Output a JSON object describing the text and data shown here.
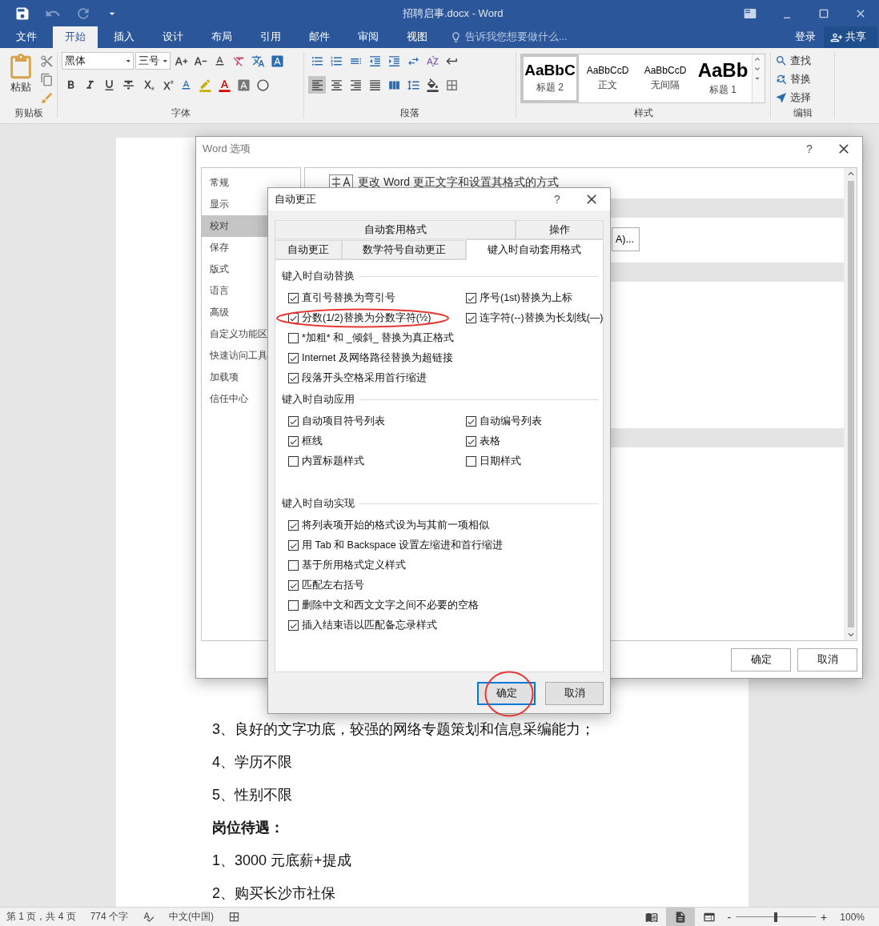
{
  "window": {
    "title": "招聘启事.docx - Word"
  },
  "ribbon_tabs": [
    {
      "label": "文件",
      "selected": false
    },
    {
      "label": "开始",
      "selected": true
    },
    {
      "label": "插入",
      "selected": false
    },
    {
      "label": "设计",
      "selected": false
    },
    {
      "label": "布局",
      "selected": false
    },
    {
      "label": "引用",
      "selected": false
    },
    {
      "label": "邮件",
      "selected": false
    },
    {
      "label": "审阅",
      "selected": false
    },
    {
      "label": "视图",
      "selected": false
    }
  ],
  "tell_me": {
    "placeholder": "告诉我您想要做什么..."
  },
  "account": {
    "sign_in": "登录",
    "share": "共享"
  },
  "ribbon": {
    "clipboard": {
      "paste": "粘贴",
      "label": "剪贴板"
    },
    "font": {
      "name": "黑体",
      "size": "三号",
      "label": "字体"
    },
    "paragraph": {
      "label": "段落"
    },
    "styles": {
      "label": "样式",
      "items": [
        {
          "sample": "AaBbC",
          "name": "标题 2",
          "kind": "heading2",
          "selected": true
        },
        {
          "sample": "AaBbCcD",
          "name": "正文",
          "kind": "body",
          "selected": false
        },
        {
          "sample": "AaBbCcD",
          "name": "无间隔",
          "kind": "body",
          "selected": false
        },
        {
          "sample": "AaBb",
          "name": "标题 1",
          "kind": "heading1",
          "selected": false
        }
      ]
    },
    "editing": {
      "label": "编辑",
      "items": [
        {
          "kind": "find",
          "label": "查找"
        },
        {
          "kind": "replace",
          "label": "替换"
        },
        {
          "kind": "select",
          "label": "选择"
        }
      ]
    }
  },
  "document": {
    "paragraphs": [
      {
        "text": "3、良好的文字功底，较强的网络专题策划和信息采编能力；",
        "bold": false
      },
      {
        "text": "4、学历不限",
        "bold": false
      },
      {
        "text": "5、性别不限",
        "bold": false
      },
      {
        "text": "岗位待遇：",
        "bold": true
      },
      {
        "text": "1、3000 元底薪+提成",
        "bold": false
      },
      {
        "text": "2、购买长沙市社保",
        "bold": false
      }
    ]
  },
  "options_dialog": {
    "title": "Word 选项",
    "help": "?",
    "nav": [
      {
        "label": "常规",
        "selected": false
      },
      {
        "label": "显示",
        "selected": false
      },
      {
        "label": "校对",
        "selected": true
      },
      {
        "label": "保存",
        "selected": false
      },
      {
        "label": "版式",
        "selected": false
      },
      {
        "label": "语言",
        "selected": false
      },
      {
        "label": "高级",
        "selected": false
      },
      {
        "label": "自定义功能区",
        "selected": false
      },
      {
        "label": "快速访问工具",
        "selected": false
      },
      {
        "label": "加载项",
        "selected": false
      },
      {
        "label": "信任中心",
        "selected": false
      }
    ],
    "heading": "更改 Word 更正文字和设置其格式的方式",
    "option_button": "A)...",
    "buttons": [
      "确定",
      "取消"
    ]
  },
  "autocorrect_dialog": {
    "title": "自动更正",
    "help": "?",
    "tab_rows": [
      [
        {
          "label": "自动套用格式",
          "selected": false
        },
        {
          "label": "操作",
          "selected": false
        }
      ],
      [
        {
          "label": "自动更正",
          "selected": false
        },
        {
          "label": "数学符号自动更正",
          "selected": false
        },
        {
          "label": "键入时自动套用格式",
          "selected": true
        }
      ]
    ],
    "sections": [
      {
        "title": "键入时自动替换",
        "items": [
          {
            "label": "直引号替换为弯引号",
            "checked": true,
            "circled": false
          },
          {
            "label": "序号(1st)替换为上标",
            "checked": true,
            "circled": false
          },
          {
            "label": "分数(1/2)替换为分数字符(½)",
            "checked": true,
            "circled": true
          },
          {
            "label": "连字符(--)替换为长划线(—)",
            "checked": true,
            "circled": false
          },
          {
            "label": "*加粗* 和 _倾斜_ 替换为真正格式",
            "checked": false,
            "circled": false
          },
          {
            "label": "Internet 及网络路径替换为超链接",
            "checked": true,
            "circled": false,
            "wide": true
          },
          {
            "label": "段落开头空格采用首行缩进",
            "checked": true,
            "circled": false,
            "wide": true
          }
        ]
      },
      {
        "title": "键入时自动应用",
        "items": [
          {
            "label": "自动项目符号列表",
            "checked": true,
            "circled": false
          },
          {
            "label": "自动编号列表",
            "checked": true,
            "circled": false
          },
          {
            "label": "框线",
            "checked": true,
            "circled": false
          },
          {
            "label": "表格",
            "checked": true,
            "circled": false
          },
          {
            "label": "内置标题样式",
            "checked": false,
            "circled": false
          },
          {
            "label": "日期样式",
            "checked": false,
            "circled": false
          }
        ]
      },
      {
        "title": "键入时自动实现",
        "items": [
          {
            "label": "将列表项开始的格式设为与其前一项相似",
            "checked": true,
            "circled": false
          },
          {
            "label": "用 Tab 和 Backspace 设置左缩进和首行缩进",
            "checked": true,
            "circled": false
          },
          {
            "label": "基于所用格式定义样式",
            "checked": false,
            "circled": false
          },
          {
            "label": "匹配左右括号",
            "checked": true,
            "circled": false
          },
          {
            "label": "删除中文和西文文字之间不必要的空格",
            "checked": false,
            "circled": false
          },
          {
            "label": "插入结束语以匹配备忘录样式",
            "checked": true,
            "circled": false
          }
        ]
      }
    ],
    "buttons": [
      {
        "label": "确定",
        "default": true,
        "circled": true
      },
      {
        "label": "取消",
        "default": false,
        "circled": false
      }
    ]
  },
  "status_bar": {
    "page": "第 1 页，共 4 页",
    "words": "774 个字",
    "language": "中文(中国)",
    "views": [
      {
        "kind": "read",
        "selected": false
      },
      {
        "kind": "print",
        "selected": true
      },
      {
        "kind": "web",
        "selected": false
      }
    ],
    "zoom_out": "-",
    "zoom_in": "+",
    "zoom": {
      "level": 0.5,
      "reading": "100%"
    }
  }
}
